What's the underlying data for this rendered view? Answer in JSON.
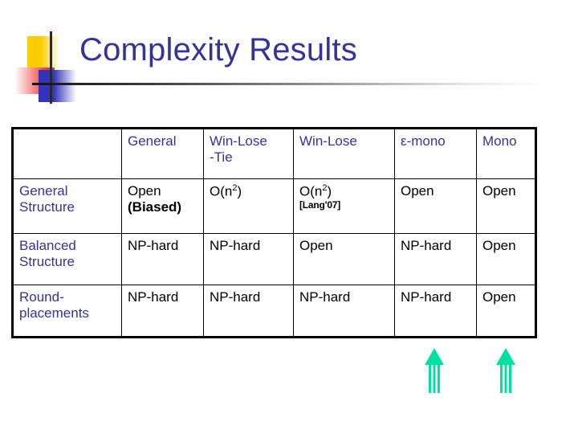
{
  "slide": {
    "title": "Complexity Results"
  },
  "logo": {
    "yellow": "#FFCC00",
    "red": "#EE3333",
    "blue": "#3333BB",
    "line": "#2a2a2a"
  },
  "theme": {
    "title_color": "#333399",
    "header_color": "#333399",
    "row_label_color": "#333399",
    "cell_color": "#000000",
    "border_color": "#000000",
    "arrow_color": "#00E0A0"
  },
  "table": {
    "headers": [
      "",
      "General",
      "Win-Lose\n-Tie",
      "Win-Lose",
      "ε-mono",
      "Mono"
    ],
    "header_line1": [
      "",
      "General",
      "Win-Lose",
      "Win-Lose",
      "ε-mono",
      "Mono"
    ],
    "header_line2": [
      "",
      "",
      "-Tie",
      "",
      "",
      ""
    ],
    "rows": [
      {
        "label_line1": "General",
        "label_line2": "Structure",
        "cells": [
          {
            "main": "Open",
            "second": "(Biased)",
            "second_bold": true,
            "bold": false,
            "superscript": "",
            "cite": ""
          },
          {
            "main": "O(n",
            "superscript": "2",
            "suffix": ")",
            "second": "",
            "bold": false,
            "cite": ""
          },
          {
            "main": "O(n",
            "superscript": "2",
            "suffix": ")",
            "second": "",
            "bold": false,
            "cite": "[Lang'07]"
          },
          {
            "main": "Open",
            "bold": false,
            "cite": ""
          },
          {
            "main": "Open",
            "bold": false,
            "cite": ""
          }
        ]
      },
      {
        "label_line1": "Balanced",
        "label_line2": "Structure",
        "cells": [
          {
            "main": "NP-hard",
            "bold": true,
            "cite": ""
          },
          {
            "main": "NP-hard",
            "bold": true,
            "cite": ""
          },
          {
            "main": "Open",
            "bold": false,
            "cite": ""
          },
          {
            "main": "NP-hard",
            "bold": true,
            "cite": ""
          },
          {
            "main": "Open",
            "bold": false,
            "cite": ""
          }
        ]
      },
      {
        "label_line1": "Round-",
        "label_line2": "placements",
        "cells": [
          {
            "main": "NP-hard",
            "bold": true,
            "cite": ""
          },
          {
            "main": "NP-hard",
            "bold": true,
            "cite": ""
          },
          {
            "main": "NP-hard",
            "bold": true,
            "cite": ""
          },
          {
            "main": "NP-hard",
            "bold": true,
            "cite": ""
          },
          {
            "main": "Open",
            "bold": false,
            "cite": ""
          }
        ]
      }
    ]
  },
  "annotations": {
    "arrows": [
      {
        "name": "arrow-emono",
        "points_to": "ε-mono",
        "direction": "up"
      },
      {
        "name": "arrow-mono",
        "points_to": "Mono",
        "direction": "up"
      }
    ]
  }
}
